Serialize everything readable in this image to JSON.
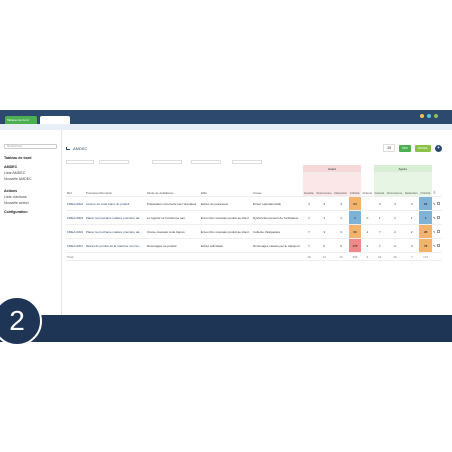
{
  "window": {
    "tab_label": "Tableau de bord"
  },
  "subbar": {
    "label": "Rechercher"
  },
  "sidebar": {
    "search_placeholder": "Rechercher",
    "items": [
      {
        "label": "Tableau de bord",
        "group": true
      },
      {
        "label": "AMDEC",
        "group": true
      },
      {
        "label": "Liste AMDEC",
        "group": false
      },
      {
        "label": "Nouvelle AMDEC",
        "group": false
      },
      {
        "label": "Actions",
        "group": true
      },
      {
        "label": "Liste d'actions",
        "group": false
      },
      {
        "label": "Nouvelle action",
        "group": false
      },
      {
        "label": "Configuration",
        "group": true
      }
    ]
  },
  "main": {
    "title": "AMDEC",
    "page_size": "25",
    "pdf_label": "PDF",
    "excel_label": "EXCEL",
    "add_label": "+"
  },
  "table": {
    "group_avant": "Avant",
    "group_apres": "Après",
    "actions_label": "Actions",
    "headers": [
      "Réf",
      "Processus/Fonction",
      "Mode de défaillance",
      "Effet",
      "Cause",
      "Gravité",
      "Occurrence",
      "Détection",
      "Criticité",
      "Actions",
      "Gravité",
      "Occurrence",
      "Détection",
      "Criticité"
    ],
    "rows": [
      {
        "ref": "FMEA-0004",
        "process": "Lecture du code barre du produit",
        "mode": "Préparation incorrecte par l'opérateur",
        "effet": "Echec du processus",
        "cause": "Erreur opérationnelle",
        "g": "4",
        "o": "4",
        "d": "4",
        "c": "64",
        "actions": "",
        "g2": "4",
        "o2": "4",
        "d2": "4",
        "c2": "64",
        "c_color": "#f4b36a",
        "c2_color": "#7fb3d5"
      },
      {
        "ref": "FMEA-0003",
        "process": "Placer la prochaine matière première da...",
        "mode": "Le logiciel ne fonctionne pas",
        "effet": "Envoi d'un mauvais produit au client",
        "cause": "Dysfonctionnement de l'ordinateur",
        "g": "1",
        "o": "1",
        "d": "1",
        "c": "1",
        "actions": "0",
        "g2": "1",
        "o2": "1",
        "d2": "1",
        "c2": "1",
        "c_color": "#7fb3d5",
        "c2_color": "#7fb3d5"
      },
      {
        "ref": "FMEA-0002",
        "process": "Placer la prochaine matière première da...",
        "mode": "Crème mauvais code barres",
        "effet": "Envoi d'un mauvais produit au client",
        "cause": "Collecte d'étiquettes",
        "g": "7",
        "o": "3",
        "d": "3",
        "c": "63",
        "actions": "1",
        "g2": "7",
        "o2": "2",
        "d2": "2",
        "c2": "28",
        "c_color": "#f4b36a",
        "c2_color": "#f4b36a"
      },
      {
        "ref": "FMEA-0001",
        "process": "Retrait du produit de la machine comme ...",
        "mode": "Dommages au produit",
        "effet": "Echec articulaire",
        "cause": "Dommages causés par le transport",
        "g": "7",
        "o": "5",
        "d": "5",
        "c": "175",
        "actions": "2",
        "g2": "7",
        "o2": "3",
        "d2": "3",
        "c2": "78",
        "c_color": "#f08a8a",
        "c2_color": "#f4b36a"
      }
    ],
    "footer": {
      "label": "Total",
      "g": "19",
      "o": "13",
      "d": "13",
      "c": "303",
      "actions": "3",
      "g2": "19",
      "o2": "10",
      "d2": "7",
      "c2": "171"
    }
  },
  "step": {
    "number": "2"
  },
  "colors": {
    "topbar": "#2d4a6e",
    "accent_green": "#4caf50",
    "pdf": "#4caf50",
    "excel": "#8bc34a",
    "bottom": "#1f3556"
  }
}
